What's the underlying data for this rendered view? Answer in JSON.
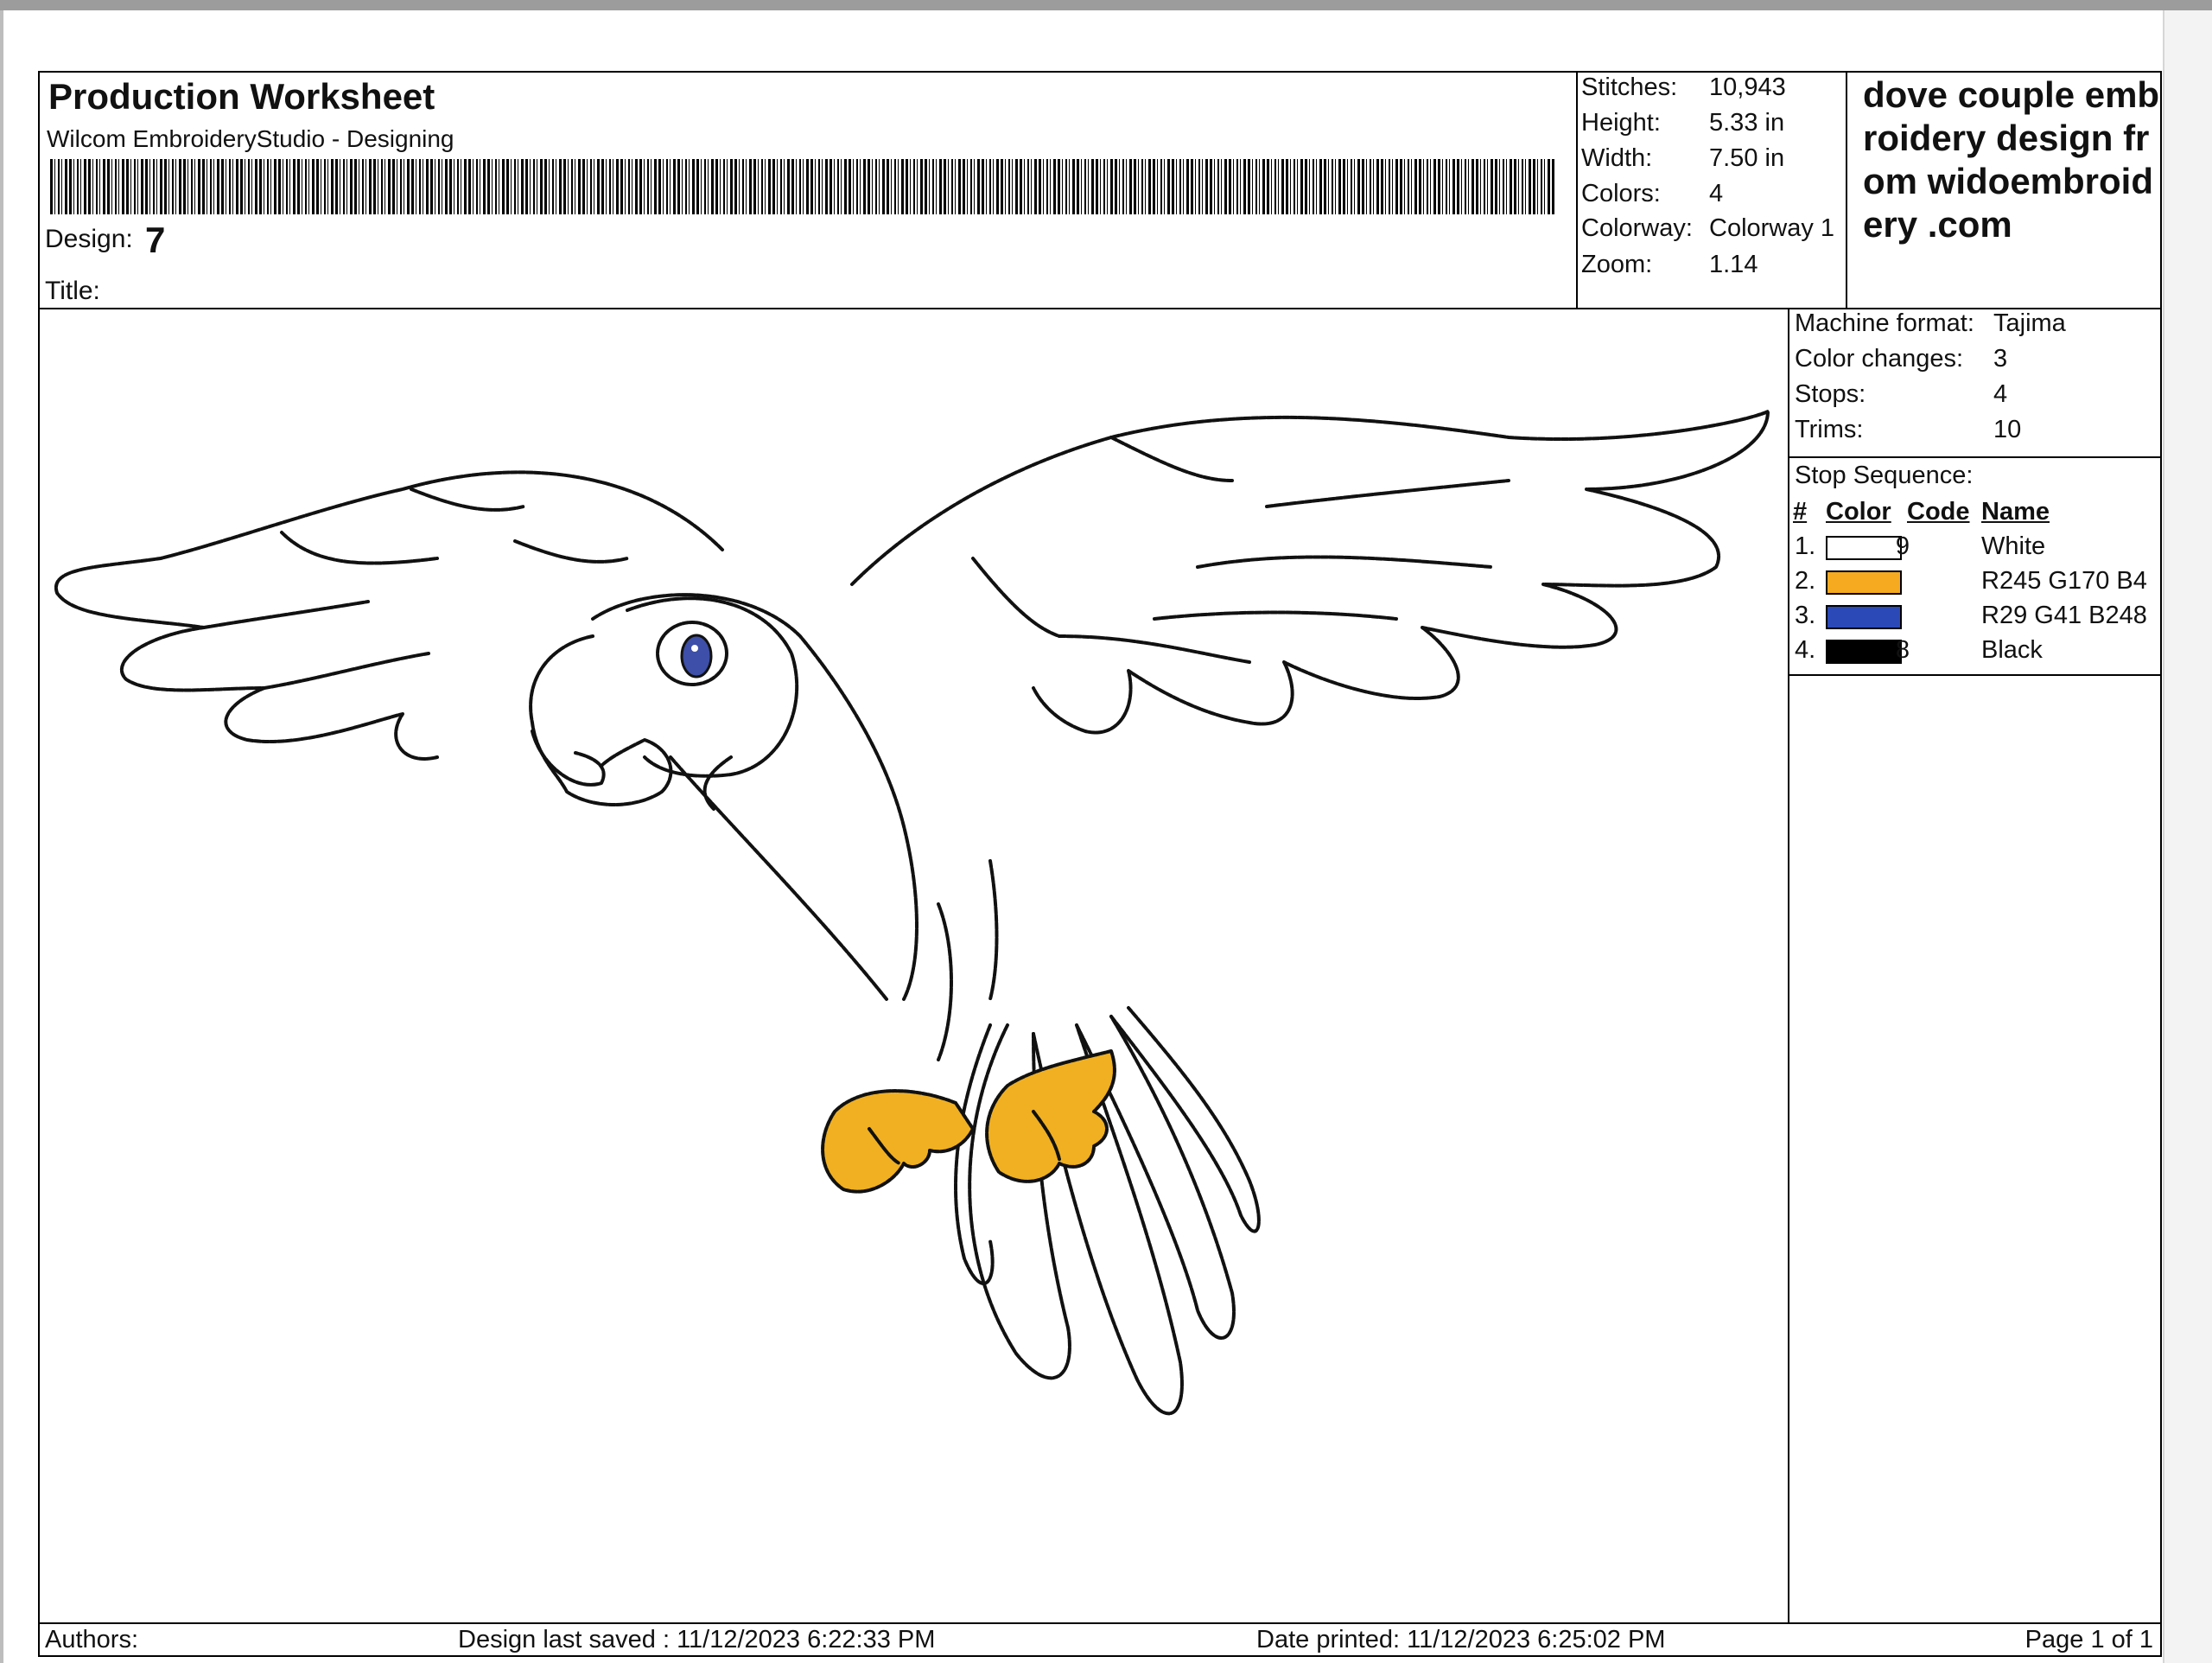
{
  "header": {
    "title": "Production Worksheet",
    "subtitle": "Wilcom EmbroideryStudio - Designing",
    "design_label": "Design:",
    "design_value": "7",
    "title_label": "Title:"
  },
  "stats": [
    {
      "label": "Stitches:",
      "value": "10,943"
    },
    {
      "label": "Height:",
      "value": "5.33 in"
    },
    {
      "label": "Width:",
      "value": "7.50 in"
    },
    {
      "label": "Colors:",
      "value": "4"
    },
    {
      "label": "Colorway:",
      "value": "Colorway 1"
    },
    {
      "label": "Zoom:",
      "value": "1.14"
    }
  ],
  "brand": "dove couple embroidery design from widoembroidery .com",
  "machine": [
    {
      "label": "Machine format:",
      "value": "Tajima"
    },
    {
      "label": "Color changes:",
      "value": "3"
    },
    {
      "label": "Stops:",
      "value": "4"
    },
    {
      "label": "Trims:",
      "value": "10"
    }
  ],
  "stop_sequence": {
    "title": "Stop Sequence:",
    "headers": {
      "num": "#",
      "color": "Color",
      "code": "Code",
      "name": "Name"
    },
    "rows": [
      {
        "num": "1.",
        "color": "#ffffff",
        "code": "9",
        "name": "White"
      },
      {
        "num": "2.",
        "color": "#f5aa20",
        "code": "",
        "name": "R245 G170 B4"
      },
      {
        "num": "3.",
        "color": "#2c49b8",
        "code": "",
        "name": "R29 G41 B248"
      },
      {
        "num": "4.",
        "color": "#000000",
        "code": "8",
        "name": "Black"
      }
    ]
  },
  "footer": {
    "authors": "Authors:",
    "saved": "Design last saved : 11/12/2023 6:22:33 PM",
    "printed": "Date printed: 11/12/2023 6:25:02 PM",
    "page": "Page 1 of 1"
  },
  "colors": {
    "feet": "#f0b021",
    "eye": "#3d4fa8"
  }
}
